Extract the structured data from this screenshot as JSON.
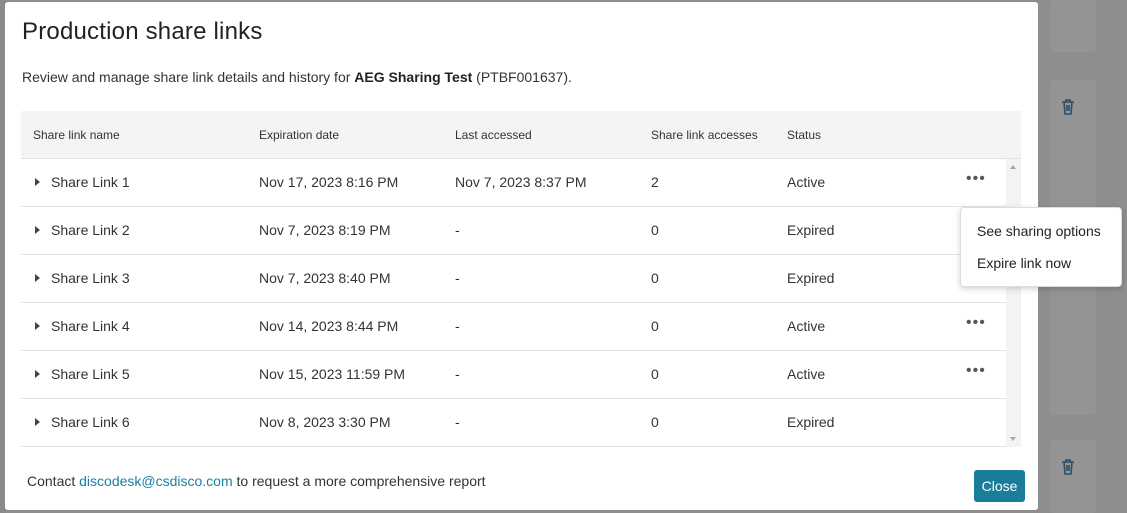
{
  "modal": {
    "title": "Production share links",
    "subtitle_prefix": "Review and manage share link details and history for ",
    "production_name": "AEG Sharing Test",
    "production_id": " (PTBF001637)."
  },
  "table": {
    "headers": [
      "Share link name",
      "Expiration date",
      "Last accessed",
      "Share link accesses",
      "Status"
    ],
    "rows": [
      {
        "name": "Share Link 1",
        "expiration": "Nov 17, 2023 8:16 PM",
        "last_accessed": "Nov 7, 2023 8:37 PM",
        "accesses": "2",
        "status": "Active",
        "has_menu": true
      },
      {
        "name": "Share Link 2",
        "expiration": "Nov 7, 2023 8:19 PM",
        "last_accessed": "-",
        "accesses": "0",
        "status": "Expired",
        "has_menu": false
      },
      {
        "name": "Share Link 3",
        "expiration": "Nov 7, 2023 8:40 PM",
        "last_accessed": "-",
        "accesses": "0",
        "status": "Expired",
        "has_menu": false
      },
      {
        "name": "Share Link 4",
        "expiration": "Nov 14, 2023 8:44 PM",
        "last_accessed": "-",
        "accesses": "0",
        "status": "Active",
        "has_menu": true
      },
      {
        "name": "Share Link 5",
        "expiration": "Nov 15, 2023 11:59 PM",
        "last_accessed": "-",
        "accesses": "0",
        "status": "Active",
        "has_menu": true
      },
      {
        "name": "Share Link 6",
        "expiration": "Nov 8, 2023 3:30 PM",
        "last_accessed": "-",
        "accesses": "0",
        "status": "Expired",
        "has_menu": false
      }
    ],
    "more_glyph": "•••"
  },
  "menu": {
    "items": [
      "See sharing options",
      "Expire link now"
    ]
  },
  "footer": {
    "prefix": "Contact ",
    "email": "discodesk@csdisco.com",
    "suffix": " to request a more comprehensive report",
    "close_label": "Close"
  },
  "colors": {
    "accent": "#1a7d99",
    "link": "#1b7fa3",
    "overlay": "#8e8e8e"
  },
  "icons": {
    "row_expand": "caret-right-icon",
    "row_actions": "more-horizontal-icon",
    "background_delete": "trash-icon"
  }
}
